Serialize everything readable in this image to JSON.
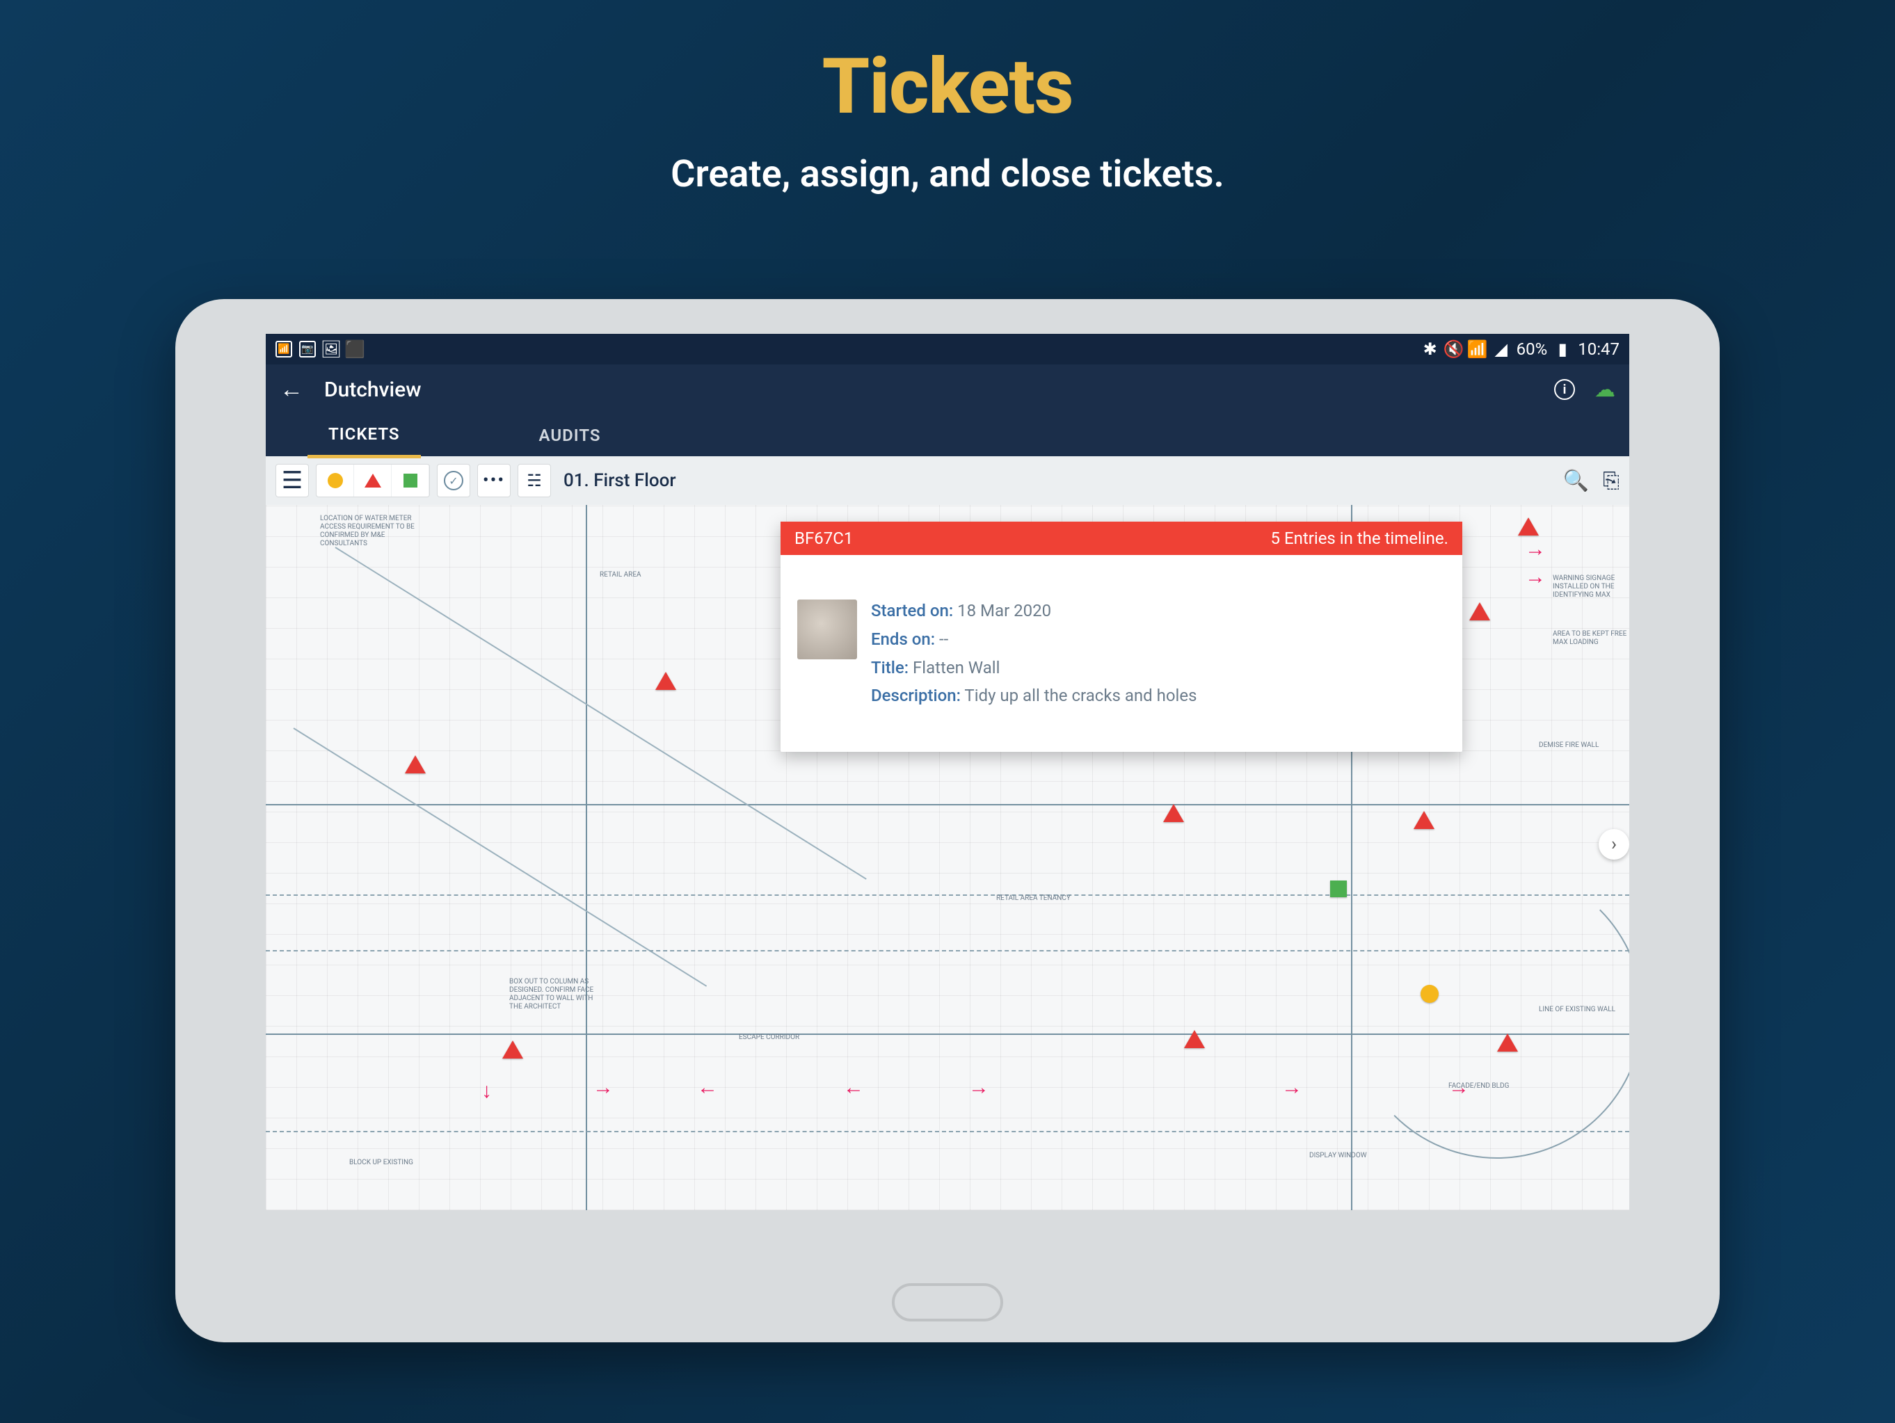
{
  "promo": {
    "title": "Tickets",
    "subtitle": "Create, assign, and close tickets."
  },
  "status_bar": {
    "battery_text": "60%",
    "time": "10:47"
  },
  "app_bar": {
    "title": "Dutchview"
  },
  "tabs": [
    {
      "label": "TICKETS",
      "active": true
    },
    {
      "label": "AUDITS",
      "active": false
    }
  ],
  "toolbar": {
    "floor_label": "01. First Floor"
  },
  "ticket_card": {
    "id": "BF67C1",
    "timeline_text": "5 Entries in the timeline.",
    "fields": {
      "started_on_label": "Started on:",
      "started_on_value": "18 Mar 2020",
      "ends_on_label": "Ends on:",
      "ends_on_value": "--",
      "title_label": "Title:",
      "title_value": "Flatten Wall",
      "description_label": "Description:",
      "description_value": "Tidy up all the cracks and holes"
    }
  },
  "plan_labels": {
    "l1": "LOCATION OF WATER METER ACCESS REQUIREMENT TO BE CONFIRMED BY M&E CONSULTANTS",
    "l2": "RETAIL AREA",
    "l3": "WARNING SIGNAGE INSTALLED ON THE IDENTIFYING MAX",
    "l4": "AREA TO BE KEPT FREE MAX LOADING",
    "l5": "DEMISE FIRE WALL",
    "l6": "BOX OUT TO COLUMN AS DESIGNED. CONFIRM FACE ADJACENT TO WALL WITH THE ARCHITECT",
    "l7": "ESCAPE CORRIDOR",
    "l8": "BLOCK UP EXISTING",
    "l9": "RETAIL AREA TENANCY",
    "l10": "LINE OF EXISTING WALL",
    "l11": "DISPLAY WINDOW",
    "l12": "FACADE/END BLDG"
  }
}
